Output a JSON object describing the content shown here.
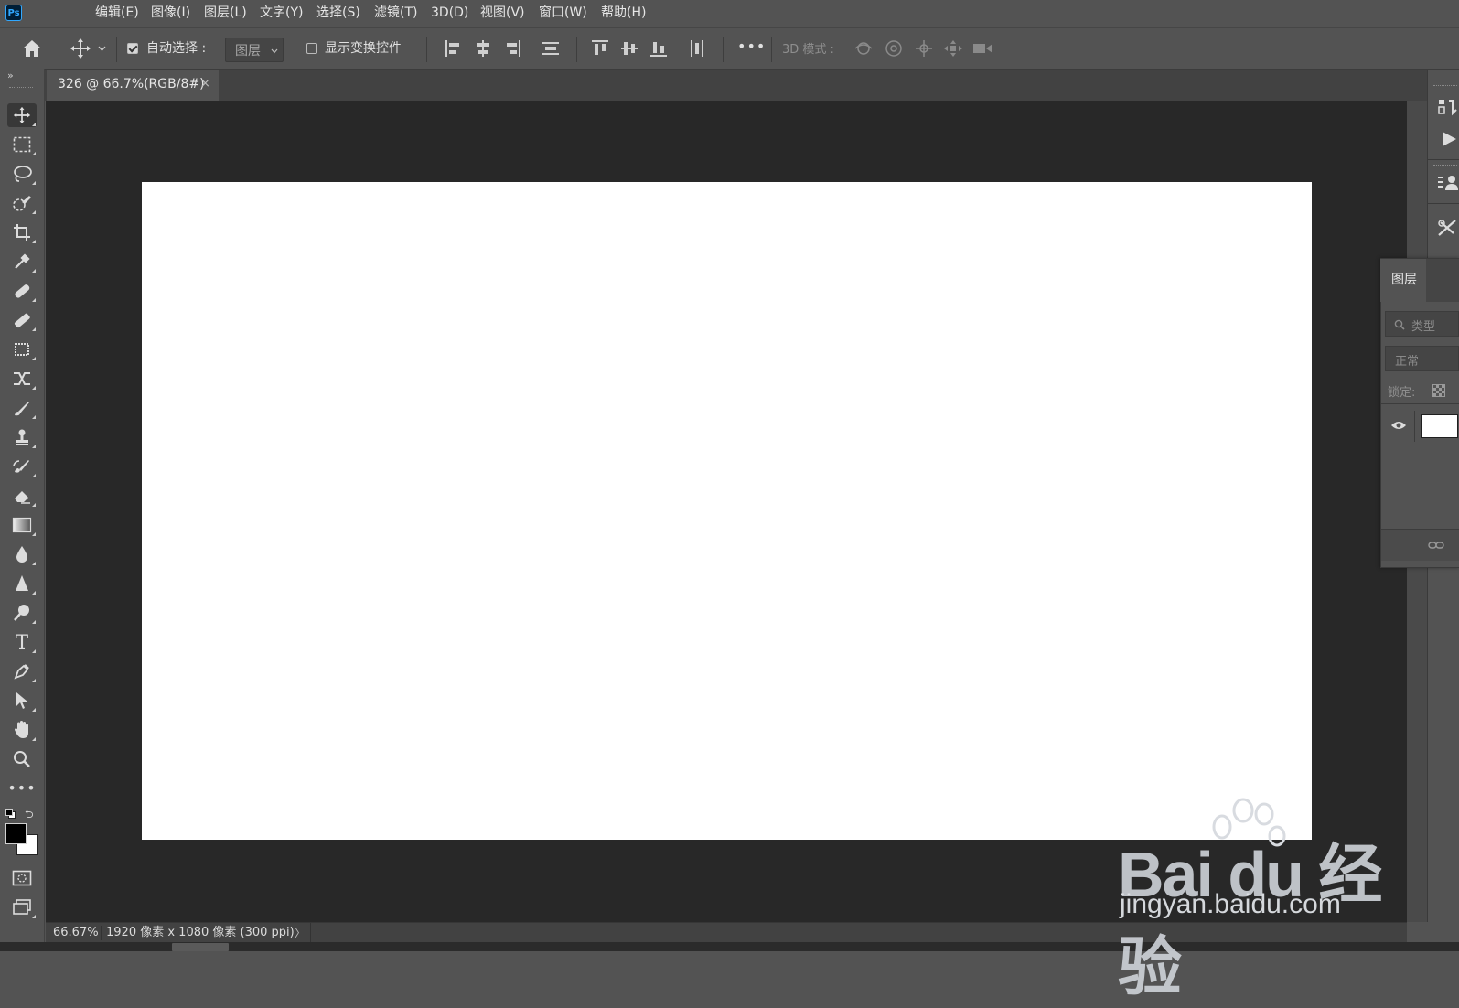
{
  "app": {
    "logo_text": "Ps"
  },
  "menu": [
    "编辑(E)",
    "图像(I)",
    "图层(L)",
    "文字(Y)",
    "选择(S)",
    "滤镜(T)",
    "3D(D)",
    "视图(V)",
    "窗口(W)",
    "帮助(H)"
  ],
  "options_bar": {
    "auto_select_label": "自动选择 :",
    "auto_select_checked": true,
    "auto_select_target": "图层",
    "show_transform_label": "显示变换控件",
    "show_transform_checked": false,
    "more_label": "•••",
    "mode_3d_label": "3D 模式 :"
  },
  "document": {
    "tab_title": "326 @ 66.7%(RGB/8#)",
    "tab_close": "×",
    "canvas_color": "#ffffff"
  },
  "status_bar": {
    "zoom": "66.67%",
    "doc_info": "1920 像素 x 1080 像素 (300 ppi)",
    "arrow": "〉"
  },
  "layers_panel": {
    "tab_label": "图层",
    "search_placeholder": "类型",
    "blend_mode": "正常",
    "lock_label": "锁定:"
  },
  "watermark": {
    "brand": "Bai du 经验",
    "url": "jingyan.baidu.com"
  },
  "colors": {
    "ui_bg": "#535353",
    "pasteboard": "#282828",
    "accent": "#31a8ff"
  }
}
